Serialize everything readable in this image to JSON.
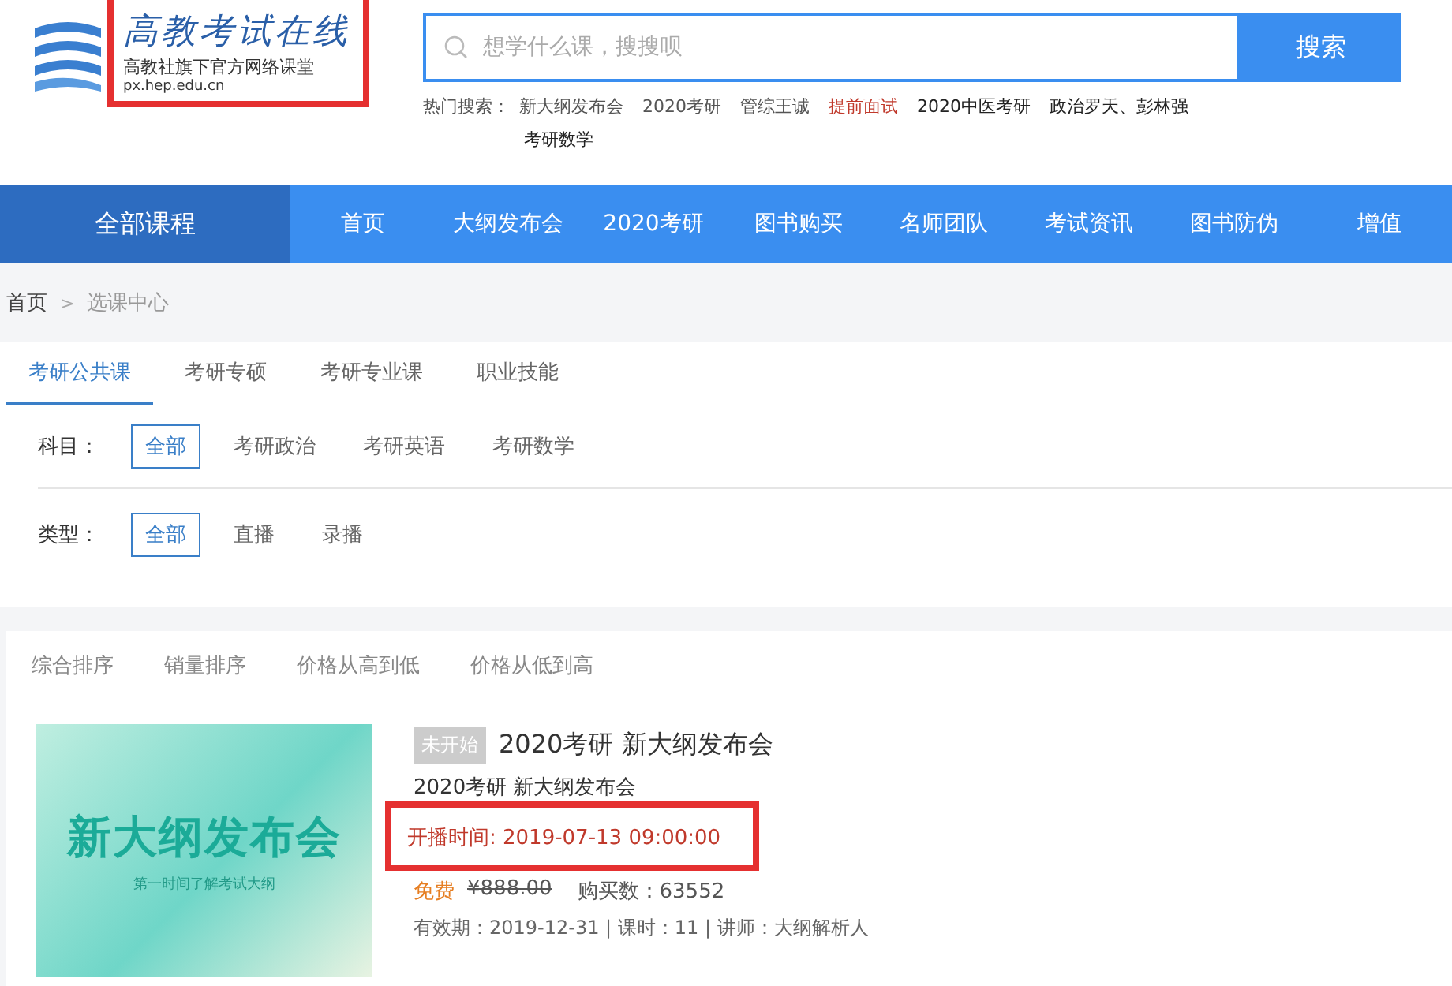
{
  "logo": {
    "title": "高教考试在线",
    "subtitle": "高教社旗下官方网络课堂",
    "url": "px.hep.edu.cn",
    "highlighted": true
  },
  "search": {
    "placeholder": "想学什么课，搜搜呗",
    "button": "搜索"
  },
  "hot_search": {
    "label": "热门搜索：",
    "items": [
      {
        "text": "新大纲发布会",
        "hot": false
      },
      {
        "text": "2020考研",
        "hot": false
      },
      {
        "text": "管综王诚",
        "hot": false
      },
      {
        "text": "提前面试",
        "hot": true
      },
      {
        "text": "2020中医考研",
        "hot": false
      },
      {
        "text": "政治罗天、彭林强",
        "hot": false
      },
      {
        "text": "考研数学",
        "hot": false
      }
    ]
  },
  "nav": {
    "all_courses": "全部课程",
    "items": [
      "首页",
      "大纲发布会",
      "2020考研",
      "图书购买",
      "名师团队",
      "考试资讯",
      "图书防伪",
      "增值"
    ]
  },
  "breadcrumb": {
    "separator": ">",
    "items": [
      "首页",
      "选课中心"
    ]
  },
  "tabs": [
    {
      "label": "考研公共课",
      "selected": true
    },
    {
      "label": "考研专硕",
      "selected": false
    },
    {
      "label": "考研专业课",
      "selected": false
    },
    {
      "label": "职业技能",
      "selected": false
    }
  ],
  "filters": [
    {
      "label": "科目：",
      "options": [
        {
          "label": "全部",
          "selected": true
        },
        {
          "label": "考研政治",
          "selected": false
        },
        {
          "label": "考研英语",
          "selected": false
        },
        {
          "label": "考研数学",
          "selected": false
        }
      ]
    },
    {
      "label": "类型：",
      "options": [
        {
          "label": "全部",
          "selected": true
        },
        {
          "label": "直播",
          "selected": false
        },
        {
          "label": "录播",
          "selected": false
        }
      ]
    }
  ],
  "sort": [
    "综合排序",
    "销量排序",
    "价格从高到低",
    "价格从低到高"
  ],
  "course": {
    "thumbnail": {
      "title": "新大纲发布会",
      "subtitle": "第一时间了解考试大纲"
    },
    "status": "未开始",
    "title": "2020考研 新大纲发布会",
    "subtitle": "2020考研 新大纲发布会",
    "start_time": "开播时间: 2019-07-13 09:00:00",
    "start_time_highlighted": true,
    "price": "免费",
    "original_price": "¥888.00",
    "buyers": "购买数：63552",
    "meta": "有效期：2019-12-31 | 课时：11 | 讲师：大纲解析人"
  }
}
